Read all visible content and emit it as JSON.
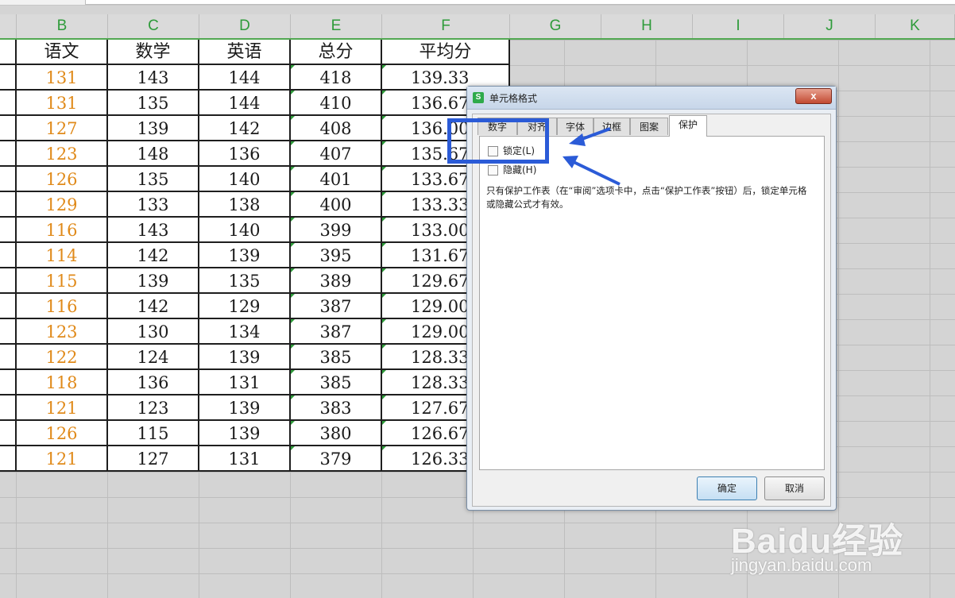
{
  "formula_bar": {
    "value": ""
  },
  "columns": [
    "B",
    "C",
    "D",
    "E",
    "F",
    "G",
    "H",
    "I",
    "J",
    "K"
  ],
  "table": {
    "headers": [
      "语文",
      "数学",
      "英语",
      "总分",
      "平均分"
    ],
    "rows": [
      [
        "131",
        "143",
        "144",
        "418",
        "139.33"
      ],
      [
        "131",
        "135",
        "144",
        "410",
        "136.67"
      ],
      [
        "127",
        "139",
        "142",
        "408",
        "136.00"
      ],
      [
        "123",
        "148",
        "136",
        "407",
        "135.67"
      ],
      [
        "126",
        "135",
        "140",
        "401",
        "133.67"
      ],
      [
        "129",
        "133",
        "138",
        "400",
        "133.33"
      ],
      [
        "116",
        "143",
        "140",
        "399",
        "133.00"
      ],
      [
        "114",
        "142",
        "139",
        "395",
        "131.67"
      ],
      [
        "115",
        "139",
        "135",
        "389",
        "129.67"
      ],
      [
        "116",
        "142",
        "129",
        "387",
        "129.00"
      ],
      [
        "123",
        "130",
        "134",
        "387",
        "129.00"
      ],
      [
        "122",
        "124",
        "139",
        "385",
        "128.33"
      ],
      [
        "118",
        "136",
        "131",
        "385",
        "128.33"
      ],
      [
        "121",
        "123",
        "139",
        "383",
        "127.67"
      ],
      [
        "126",
        "115",
        "139",
        "380",
        "126.67"
      ],
      [
        "121",
        "127",
        "131",
        "379",
        "126.33"
      ]
    ]
  },
  "dialog": {
    "app_icon": "S",
    "title": "单元格格式",
    "close_label": "x",
    "tabs": [
      "数字",
      "对齐",
      "字体",
      "边框",
      "图案",
      "保护"
    ],
    "active_tab": "保护",
    "lock_label": "锁定(L)",
    "hide_label": "隐藏(H)",
    "note": "只有保护工作表（在“审阅”选项卡中，点击“保护工作表”按钮）后，锁定单元格或隐藏公式才有效。",
    "ok_label": "确定",
    "cancel_label": "取消"
  },
  "annotation": {
    "color": "#2b5bd7"
  },
  "watermark": {
    "logo": "Baidu经验",
    "url": "jingyan.baidu.com"
  },
  "colors": {
    "column_header_text": "#2e9b3a",
    "chinese_score": "#e08a1a"
  }
}
